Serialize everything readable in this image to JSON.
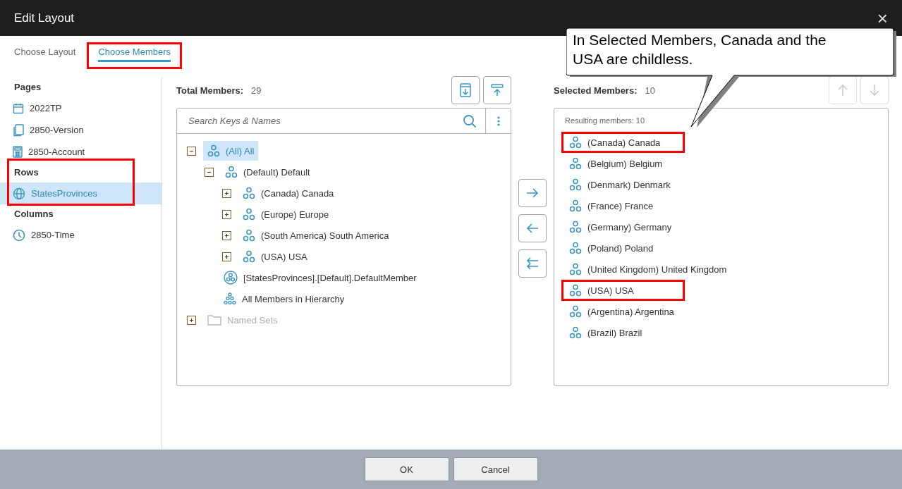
{
  "window": {
    "title": "Edit Layout",
    "close": "×"
  },
  "tabs": [
    {
      "label": "Choose Layout",
      "selected": false,
      "highlighted": false
    },
    {
      "label": "Choose Members",
      "selected": true,
      "highlighted": true
    }
  ],
  "sidebar": {
    "groups": [
      {
        "label": "Pages",
        "highlighted": false,
        "items": [
          {
            "label": "2022TP",
            "kind": "calendar",
            "selected": false
          },
          {
            "label": "2850-Version",
            "kind": "pages",
            "selected": false
          },
          {
            "label": "2850-Account",
            "kind": "calculator",
            "selected": false
          }
        ]
      },
      {
        "label": "Rows",
        "highlighted": true,
        "items": [
          {
            "label": "StatesProvinces",
            "kind": "globe",
            "selected": true
          }
        ]
      },
      {
        "label": "Columns",
        "highlighted": false,
        "items": [
          {
            "label": "2850-Time",
            "kind": "clock",
            "selected": false
          }
        ]
      }
    ]
  },
  "total": {
    "label": "Total Members:",
    "count": "29",
    "search": {
      "placeholder": "Search Keys & Names"
    },
    "tree": [
      {
        "label": "(All) All",
        "kind": "member",
        "expanded": true,
        "selected": true,
        "disabled": false,
        "children": [
          {
            "label": "(Default) Default",
            "kind": "member",
            "expanded": true,
            "selected": false,
            "disabled": false,
            "children": [
              {
                "label": "(Canada) Canada",
                "kind": "member",
                "expanded": false,
                "selected": false,
                "disabled": false
              },
              {
                "label": "(Europe) Europe",
                "kind": "member",
                "expanded": false,
                "selected": false,
                "disabled": false
              },
              {
                "label": "(South America) South America",
                "kind": "member",
                "expanded": false,
                "selected": false,
                "disabled": false
              },
              {
                "label": "(USA) USA",
                "kind": "member",
                "expanded": false,
                "selected": false,
                "disabled": false
              }
            ]
          },
          {
            "label": "[StatesProvinces].[Default].DefaultMember",
            "kind": "default-member",
            "selected": false,
            "disabled": false
          },
          {
            "label": "All Members in Hierarchy",
            "kind": "all-members",
            "selected": false,
            "disabled": false
          }
        ]
      },
      {
        "label": "Named Sets",
        "kind": "folder",
        "expanded": false,
        "selected": false,
        "disabled": true
      }
    ]
  },
  "selected_members": {
    "label": "Selected Members:",
    "count": "10",
    "resulting": "Resulting members: 10",
    "items": [
      {
        "label": "(Canada) Canada",
        "highlighted": true
      },
      {
        "label": "(Belgium) Belgium",
        "highlighted": false
      },
      {
        "label": "(Denmark) Denmark",
        "highlighted": false
      },
      {
        "label": "(France) France",
        "highlighted": false
      },
      {
        "label": "(Germany) Germany",
        "highlighted": false
      },
      {
        "label": "(Poland) Poland",
        "highlighted": false
      },
      {
        "label": "(United Kingdom) United Kingdom",
        "highlighted": false
      },
      {
        "label": "(USA) USA",
        "highlighted": true
      },
      {
        "label": "(Argentina) Argentina",
        "highlighted": false
      },
      {
        "label": "(Brazil) Brazil",
        "highlighted": false
      }
    ]
  },
  "callout": {
    "text": "In Selected Members, Canada and the USA are childless."
  },
  "buttons": [
    {
      "label": "OK"
    },
    {
      "label": "Cancel"
    }
  ]
}
